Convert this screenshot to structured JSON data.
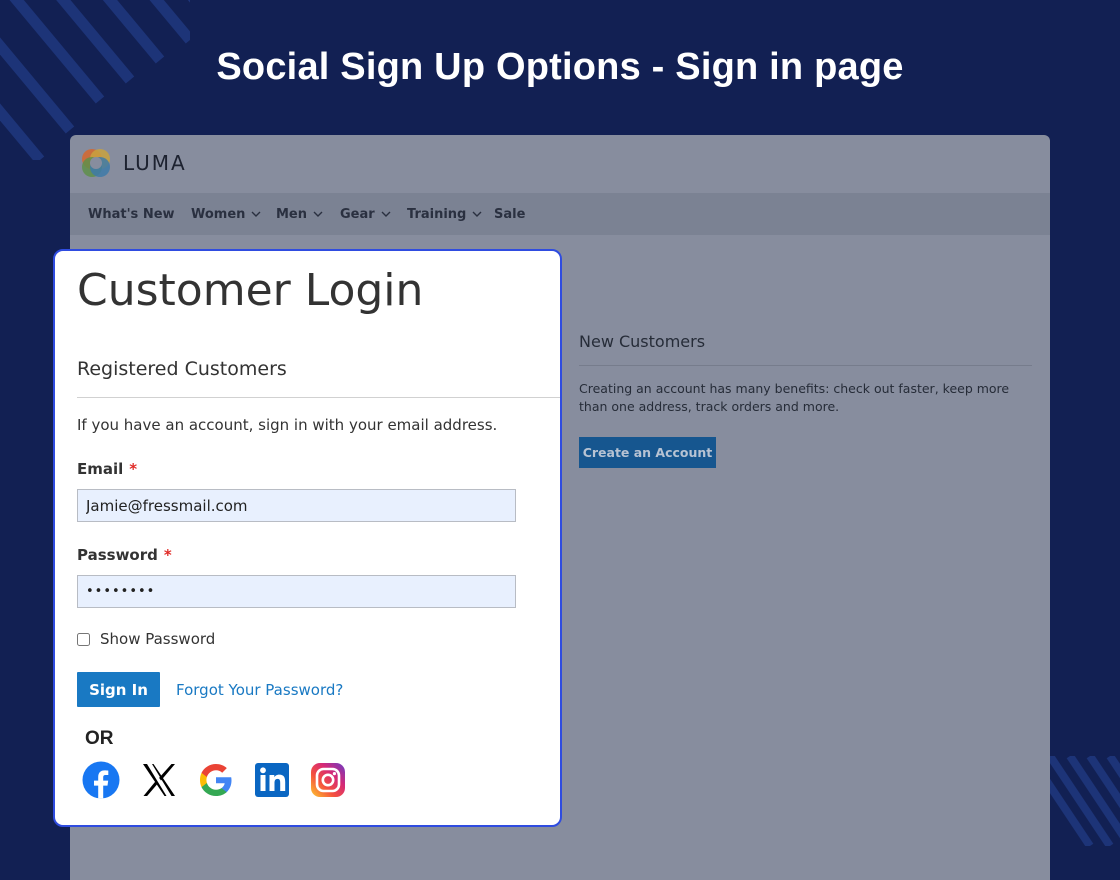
{
  "banner": {
    "title": "Social Sign Up Options - Sign in page"
  },
  "store": {
    "brand": "LUMA",
    "nav": [
      {
        "label": "What's New",
        "has_dropdown": false
      },
      {
        "label": "Women",
        "has_dropdown": true
      },
      {
        "label": "Men",
        "has_dropdown": true
      },
      {
        "label": "Gear",
        "has_dropdown": true
      },
      {
        "label": "Training",
        "has_dropdown": true
      },
      {
        "label": "Sale",
        "has_dropdown": false
      }
    ],
    "new_customers": {
      "title": "New Customers",
      "text": "Creating an account has many benefits: check out faster, keep more than one address, track orders and more.",
      "button": "Create an Account"
    }
  },
  "login": {
    "title": "Customer Login",
    "section_title": "Registered Customers",
    "instructions": "If you have an account, sign in with your email address.",
    "email_label": "Email",
    "email_value": "Jamie@fressmail.com",
    "password_label": "Password",
    "password_value": "••••••••",
    "required_mark": "*",
    "show_password_label": "Show Password",
    "show_password_checked": false,
    "sign_in_label": "Sign In",
    "forgot_label": "Forgot Your Password?",
    "or_label": "OR",
    "social": [
      "facebook-icon",
      "x-icon",
      "google-icon",
      "linkedin-icon",
      "instagram-icon"
    ]
  },
  "colors": {
    "page_bg": "#122053",
    "card_border": "#2f4ce0",
    "primary_button": "#1979c3",
    "link": "#1979c3",
    "required": "#e02b27"
  }
}
